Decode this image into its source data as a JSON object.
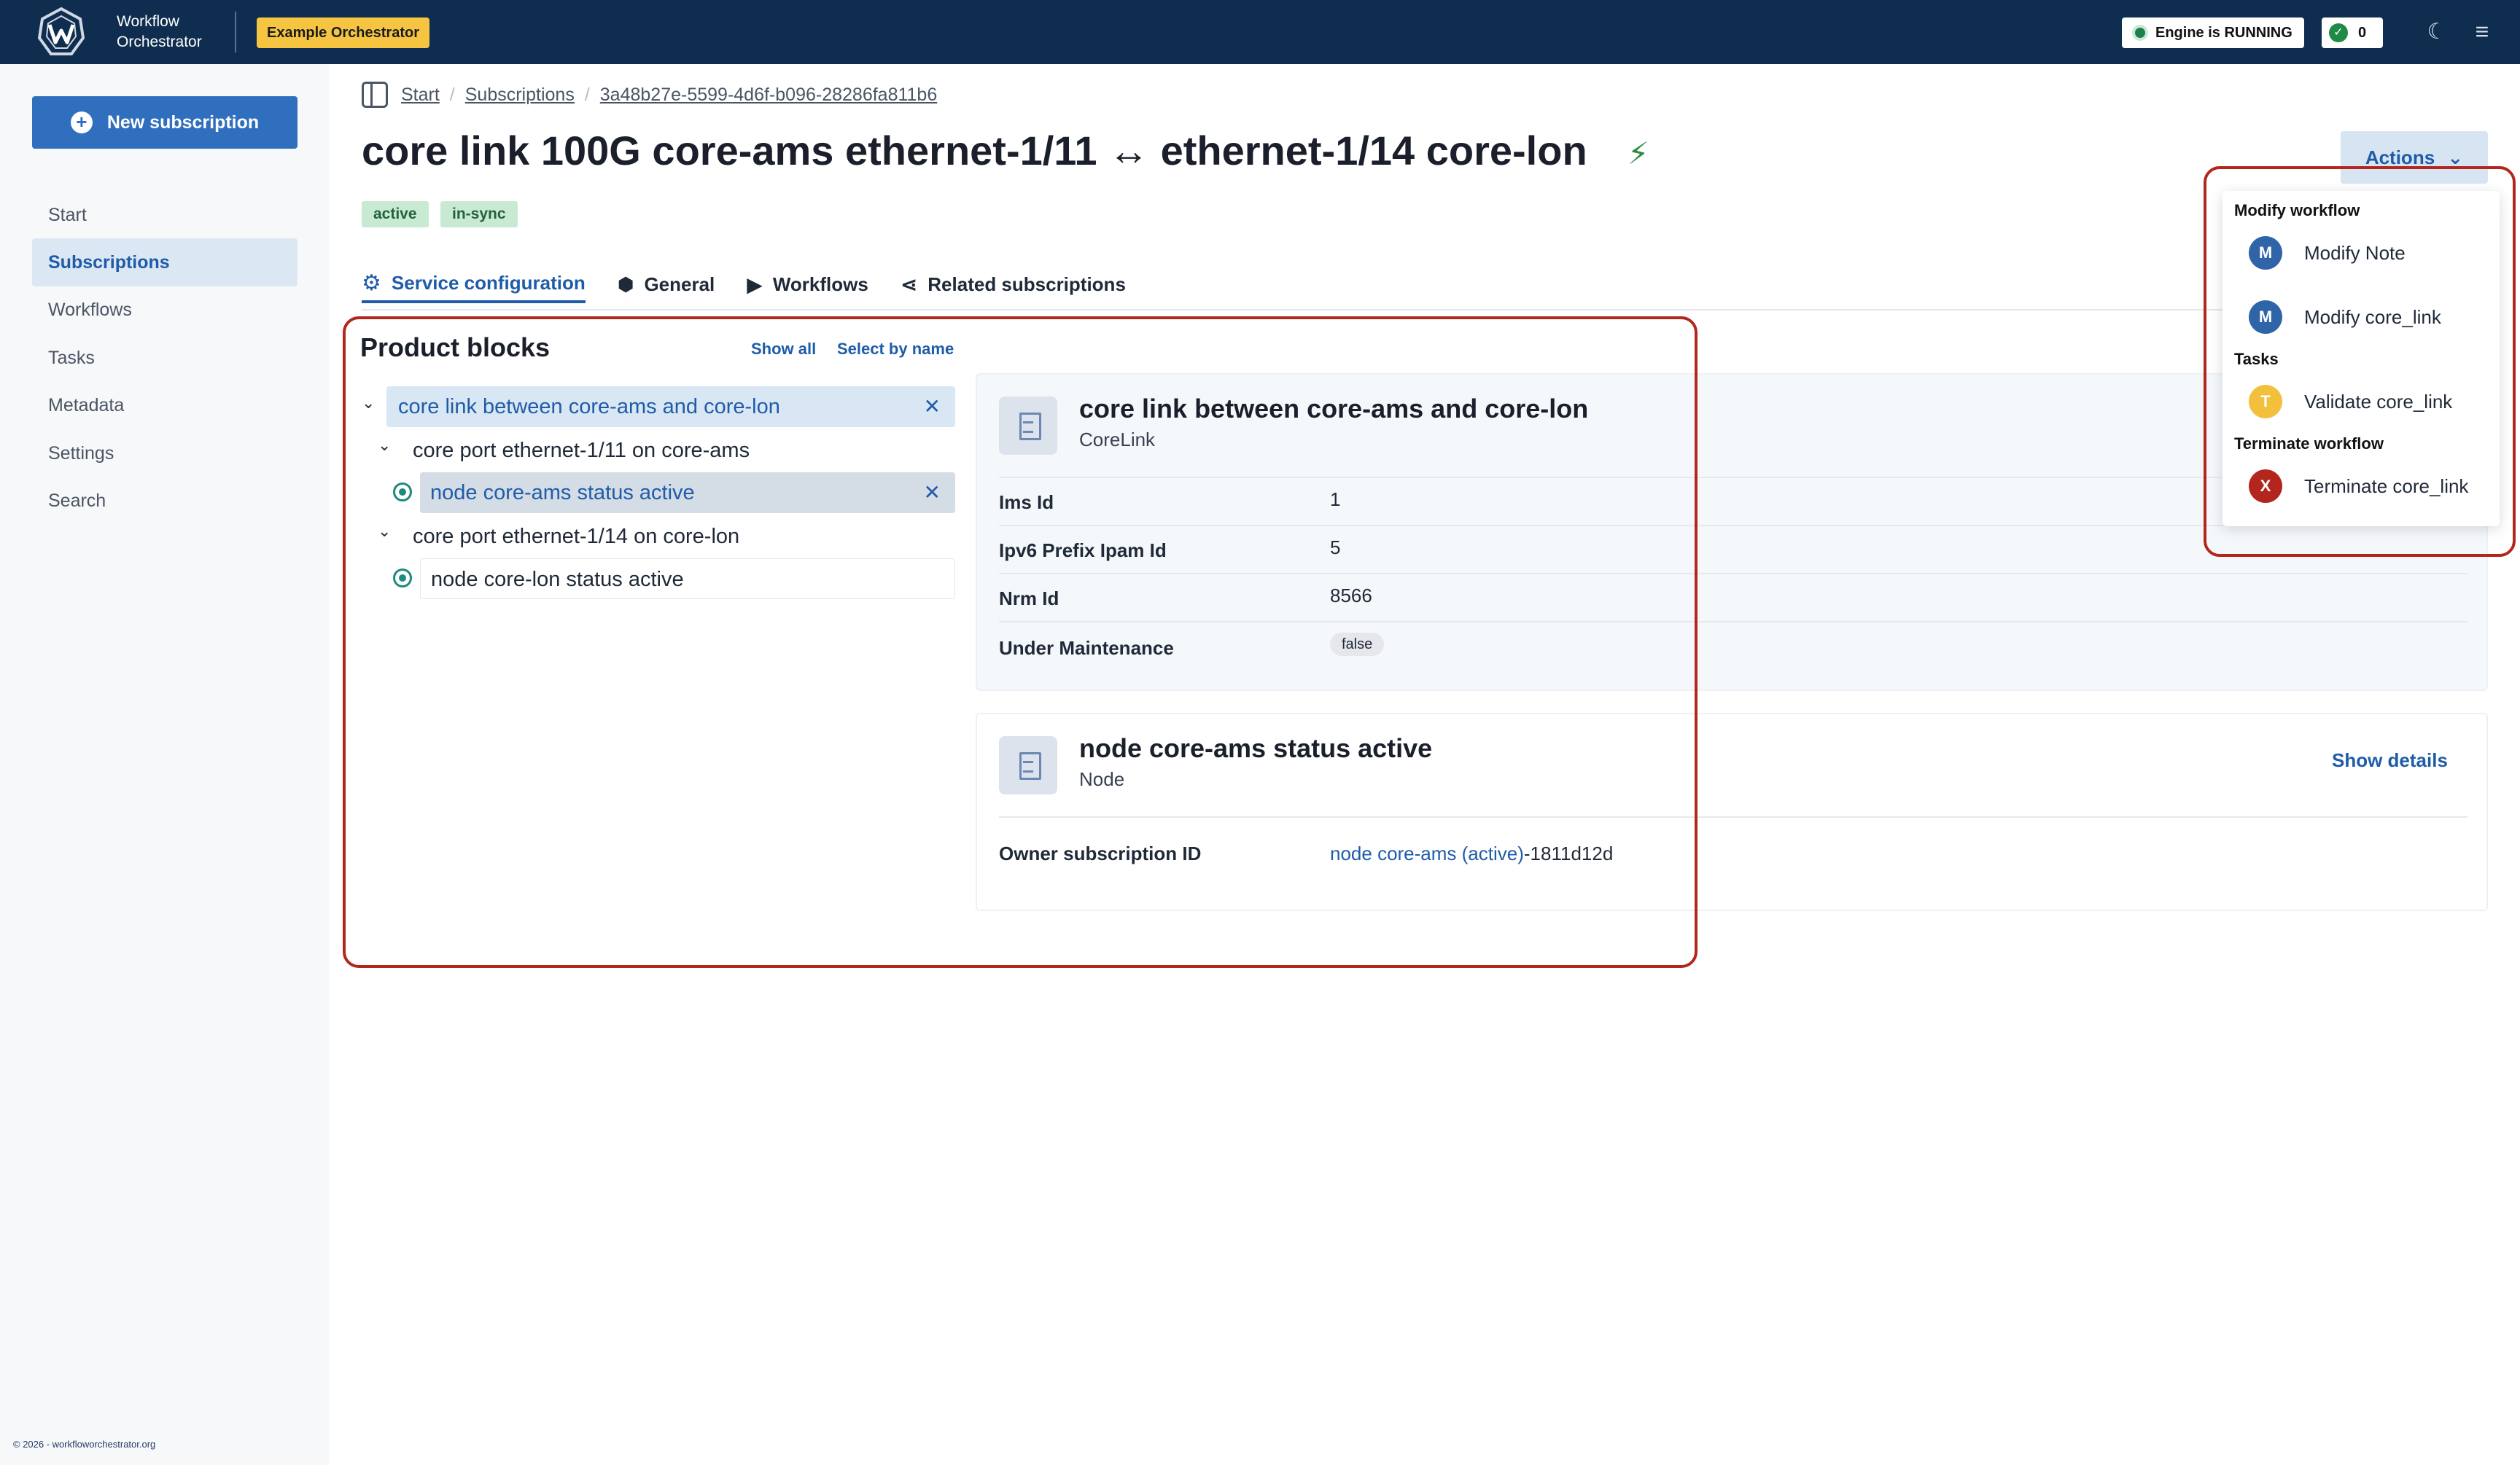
{
  "header": {
    "brand_line1": "Workflow",
    "brand_line2": "Orchestrator",
    "env_badge": "Example Orchestrator",
    "engine_status": "Engine is RUNNING",
    "engine_count": "0",
    "colors": {
      "bar": "#0f2d4f",
      "badge": "#f5c542",
      "running": "#20804a"
    }
  },
  "sidebar": {
    "new_subscription": "New subscription",
    "items": [
      "Start",
      "Subscriptions",
      "Workflows",
      "Tasks",
      "Metadata",
      "Settings",
      "Search"
    ],
    "active": "Subscriptions",
    "footer": "© 2026 - workfloworchestrator.org"
  },
  "breadcrumb": {
    "items": [
      "Start",
      "Subscriptions",
      "3a48b27e-5599-4d6f-b096-28286fa811b6"
    ]
  },
  "page": {
    "title": "core link 100G core-ams ethernet-1/11 ↔ ethernet-1/14 core-lon",
    "badges": [
      "active",
      "in-sync"
    ]
  },
  "tabs": [
    "Service configuration",
    "General",
    "Workflows",
    "Related subscriptions"
  ],
  "product_blocks": {
    "title": "Product blocks",
    "show_all": "Show all",
    "select_by_name": "Select by name",
    "tree": [
      "core link between core-ams and core-lon",
      "core port ethernet-1/11 on core-ams",
      "node core-ams status active",
      "core port ethernet-1/14 on core-lon",
      "node core-lon status active"
    ]
  },
  "panel1": {
    "title": "core link between core-ams and core-lon",
    "subtitle": "CoreLink",
    "rows": [
      {
        "label": "Ims Id",
        "value": "1"
      },
      {
        "label": "Ipv6 Prefix Ipam Id",
        "value": "5"
      },
      {
        "label": "Nrm Id",
        "value": "8566"
      },
      {
        "label": "Under Maintenance",
        "value": "false"
      }
    ]
  },
  "panel2": {
    "title": "node core-ams status active",
    "subtitle": "Node",
    "show_details": "Show details",
    "owner_label": "Owner subscription ID",
    "owner_link": "node core-ams (active)",
    "owner_suffix": "-1811d12d"
  },
  "actions": {
    "button": "Actions",
    "modify_heading": "Modify workflow",
    "modify_items": [
      "Modify Note",
      "Modify core_link"
    ],
    "tasks_heading": "Tasks",
    "task_items": [
      "Validate core_link"
    ],
    "terminate_heading": "Terminate workflow",
    "terminate_items": [
      "Terminate core_link"
    ],
    "avatars": {
      "modify": "M",
      "task": "T",
      "terminate": "X"
    },
    "colors": {
      "modify": "#2f64a8",
      "task": "#f2c03d",
      "terminate": "#b3261e"
    }
  }
}
